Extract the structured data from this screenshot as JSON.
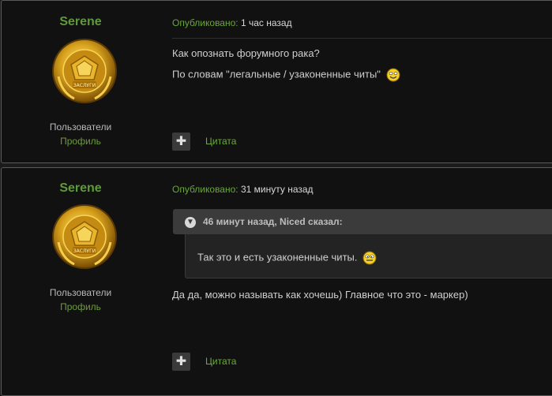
{
  "posts": [
    {
      "author": {
        "name": "Serene",
        "group": "Пользователи",
        "profile_label": "Профиль"
      },
      "meta": {
        "label": "Опубликовано:",
        "time": "1 час назад"
      },
      "lines": [
        "Как опознать форумного рака?",
        "По словам \"легальные / узаконенные читы\""
      ],
      "quote_button": "✚",
      "quote_label": "Цитата"
    },
    {
      "author": {
        "name": "Serene",
        "group": "Пользователи",
        "profile_label": "Профиль"
      },
      "meta": {
        "label": "Опубликовано:",
        "time": "31 минуту назад"
      },
      "quote": {
        "header": "46 минут назад, Niced сказал:",
        "body": "Так это и есть узаконенные читы."
      },
      "lines": [
        "Да да, можно называть как хочешь) Главное что это - маркер)"
      ],
      "quote_button": "✚",
      "quote_label": "Цитата"
    }
  ],
  "colors": {
    "username": "#5f9a3a",
    "link": "#6ea93e",
    "panel": "#111111",
    "border": "#5a5a5a"
  },
  "icons": {
    "medal": "gold-medal-icon",
    "smiley": "smiley-icon",
    "quote": "plus-icon",
    "collapse": "chevron-down-icon"
  }
}
